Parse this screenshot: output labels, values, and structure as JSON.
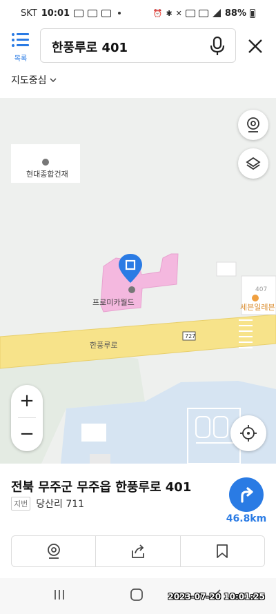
{
  "status_bar": {
    "carrier": "SKT",
    "time": "10:01",
    "battery": "88%"
  },
  "search": {
    "list_label": "목록",
    "query": "한풍루로 401"
  },
  "map_center_label": "지도중심",
  "map": {
    "poi_hyundai": "현대종합건재",
    "poi_promi": "프로미카월드",
    "poi_seven": "세븐일레븐",
    "road_name": "한풍루로",
    "route_number": "727",
    "building_no": "407"
  },
  "place": {
    "address": "전북 무주군 무주읍 한풍루로 401",
    "jibun_tag": "지번",
    "jibun": "당산리 711",
    "distance": "46.8km"
  },
  "overlay": {
    "timestamp": "2023-07-20 10:01:25"
  },
  "colors": {
    "accent": "#2a7be4",
    "road": "#f7e38a",
    "poi_building": "#f4b8df",
    "water": "#d6e4f2"
  }
}
